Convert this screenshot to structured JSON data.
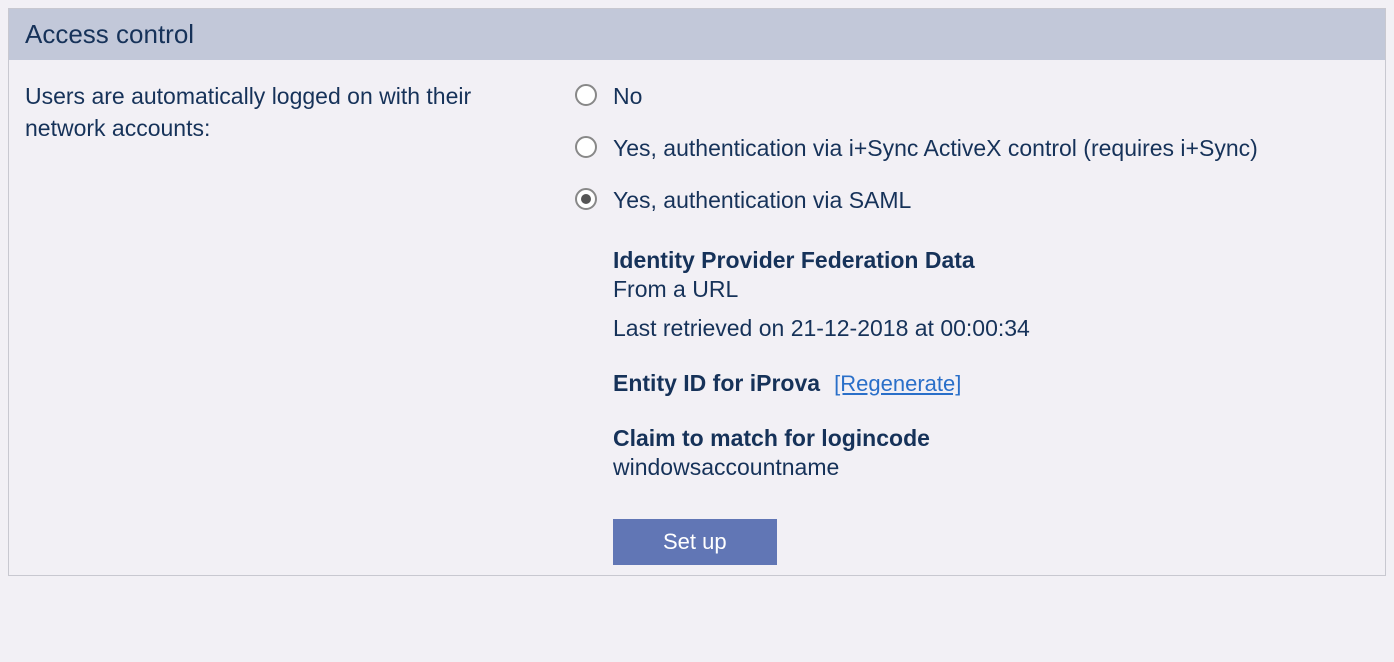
{
  "panel": {
    "title": "Access control"
  },
  "setting": {
    "label": "Users are automatically logged on with their network accounts:"
  },
  "options": {
    "no": "No",
    "isync": "Yes, authentication via i+Sync ActiveX control (requires i+Sync)",
    "saml": "Yes, authentication via SAML"
  },
  "saml": {
    "federation_heading": "Identity Provider Federation Data",
    "federation_sub": "From a URL",
    "last_retrieved": "Last retrieved on 21-12-2018 at 00:00:34",
    "entity_heading": "Entity ID for iProva",
    "regenerate": "[Regenerate]",
    "claim_heading": "Claim to match for logincode",
    "claim_value": "windowsaccountname",
    "setup_button": "Set up"
  }
}
